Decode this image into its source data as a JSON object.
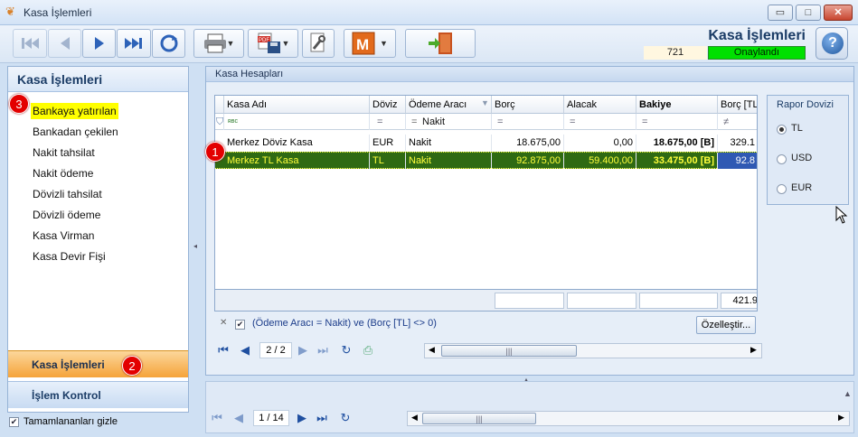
{
  "window": {
    "title": "Kasa İşlemleri",
    "minimize": "▭",
    "maximize": "□",
    "close": "✕"
  },
  "header": {
    "heading": "Kasa İşlemleri",
    "doc_number": "721",
    "status": "Onaylandı",
    "help": "?"
  },
  "sidebar": {
    "title": "Kasa İşlemleri",
    "items": [
      {
        "label": "Bankaya yatırılan"
      },
      {
        "label": "Bankadan çekilen"
      },
      {
        "label": "Nakit tahsilat"
      },
      {
        "label": "Nakit ödeme"
      },
      {
        "label": "Dövizli tahsilat"
      },
      {
        "label": "Dövizli ödeme"
      },
      {
        "label": "Kasa Virman"
      },
      {
        "label": "Kasa Devir Fişi"
      }
    ],
    "nav_primary": "Kasa İşlemleri",
    "nav_secondary": "İşlem Kontrol",
    "hide_completed": "Tamamlananları gizle"
  },
  "badges": {
    "one": "1",
    "two": "2",
    "three": "3"
  },
  "panel": {
    "title": "Kasa Hesapları",
    "columns": [
      "Kasa Adı",
      "Döviz",
      "Ödeme Aracı",
      "Borç",
      "Alacak",
      "Bakiye",
      "Borç [TL]"
    ],
    "filter": {
      "row_icon": "ʀʙc",
      "eq": "=",
      "neq": "≠",
      "payment_value": "Nakit"
    },
    "rows": [
      {
        "name": "Merkez Döviz Kasa",
        "currency": "EUR",
        "payment": "Nakit",
        "debit": "18.675,00",
        "credit": "0,00",
        "balance": "18.675,00 [B]",
        "debit_tl": "329.1"
      },
      {
        "name": "Merkez TL Kasa",
        "currency": "TL",
        "payment": "Nakit",
        "debit": "92.875,00",
        "credit": "59.400,00",
        "balance": "33.475,00 [B]",
        "debit_tl": "92.8"
      }
    ],
    "footer_total": "421.9",
    "filter_expression": "(Ödeme Aracı = Nakit) ve (Borç [TL] <> 0)",
    "customize": "Özelleştir...",
    "page_counter": "2 / 2",
    "scroll_grip": "|||"
  },
  "report_currency": {
    "title": "Rapor Dovizi",
    "options": [
      {
        "label": "TL",
        "selected": true
      },
      {
        "label": "USD",
        "selected": false
      },
      {
        "label": "EUR",
        "selected": false
      }
    ]
  },
  "bottom": {
    "page_counter": "1 / 14",
    "scroll_grip": "|||"
  },
  "colors": {
    "accent": "#1b3c66",
    "status_green": "#00e000",
    "selected_row": "#2f6a13",
    "highlight_yellow": "#ffff00",
    "badge_red": "#e30000"
  }
}
